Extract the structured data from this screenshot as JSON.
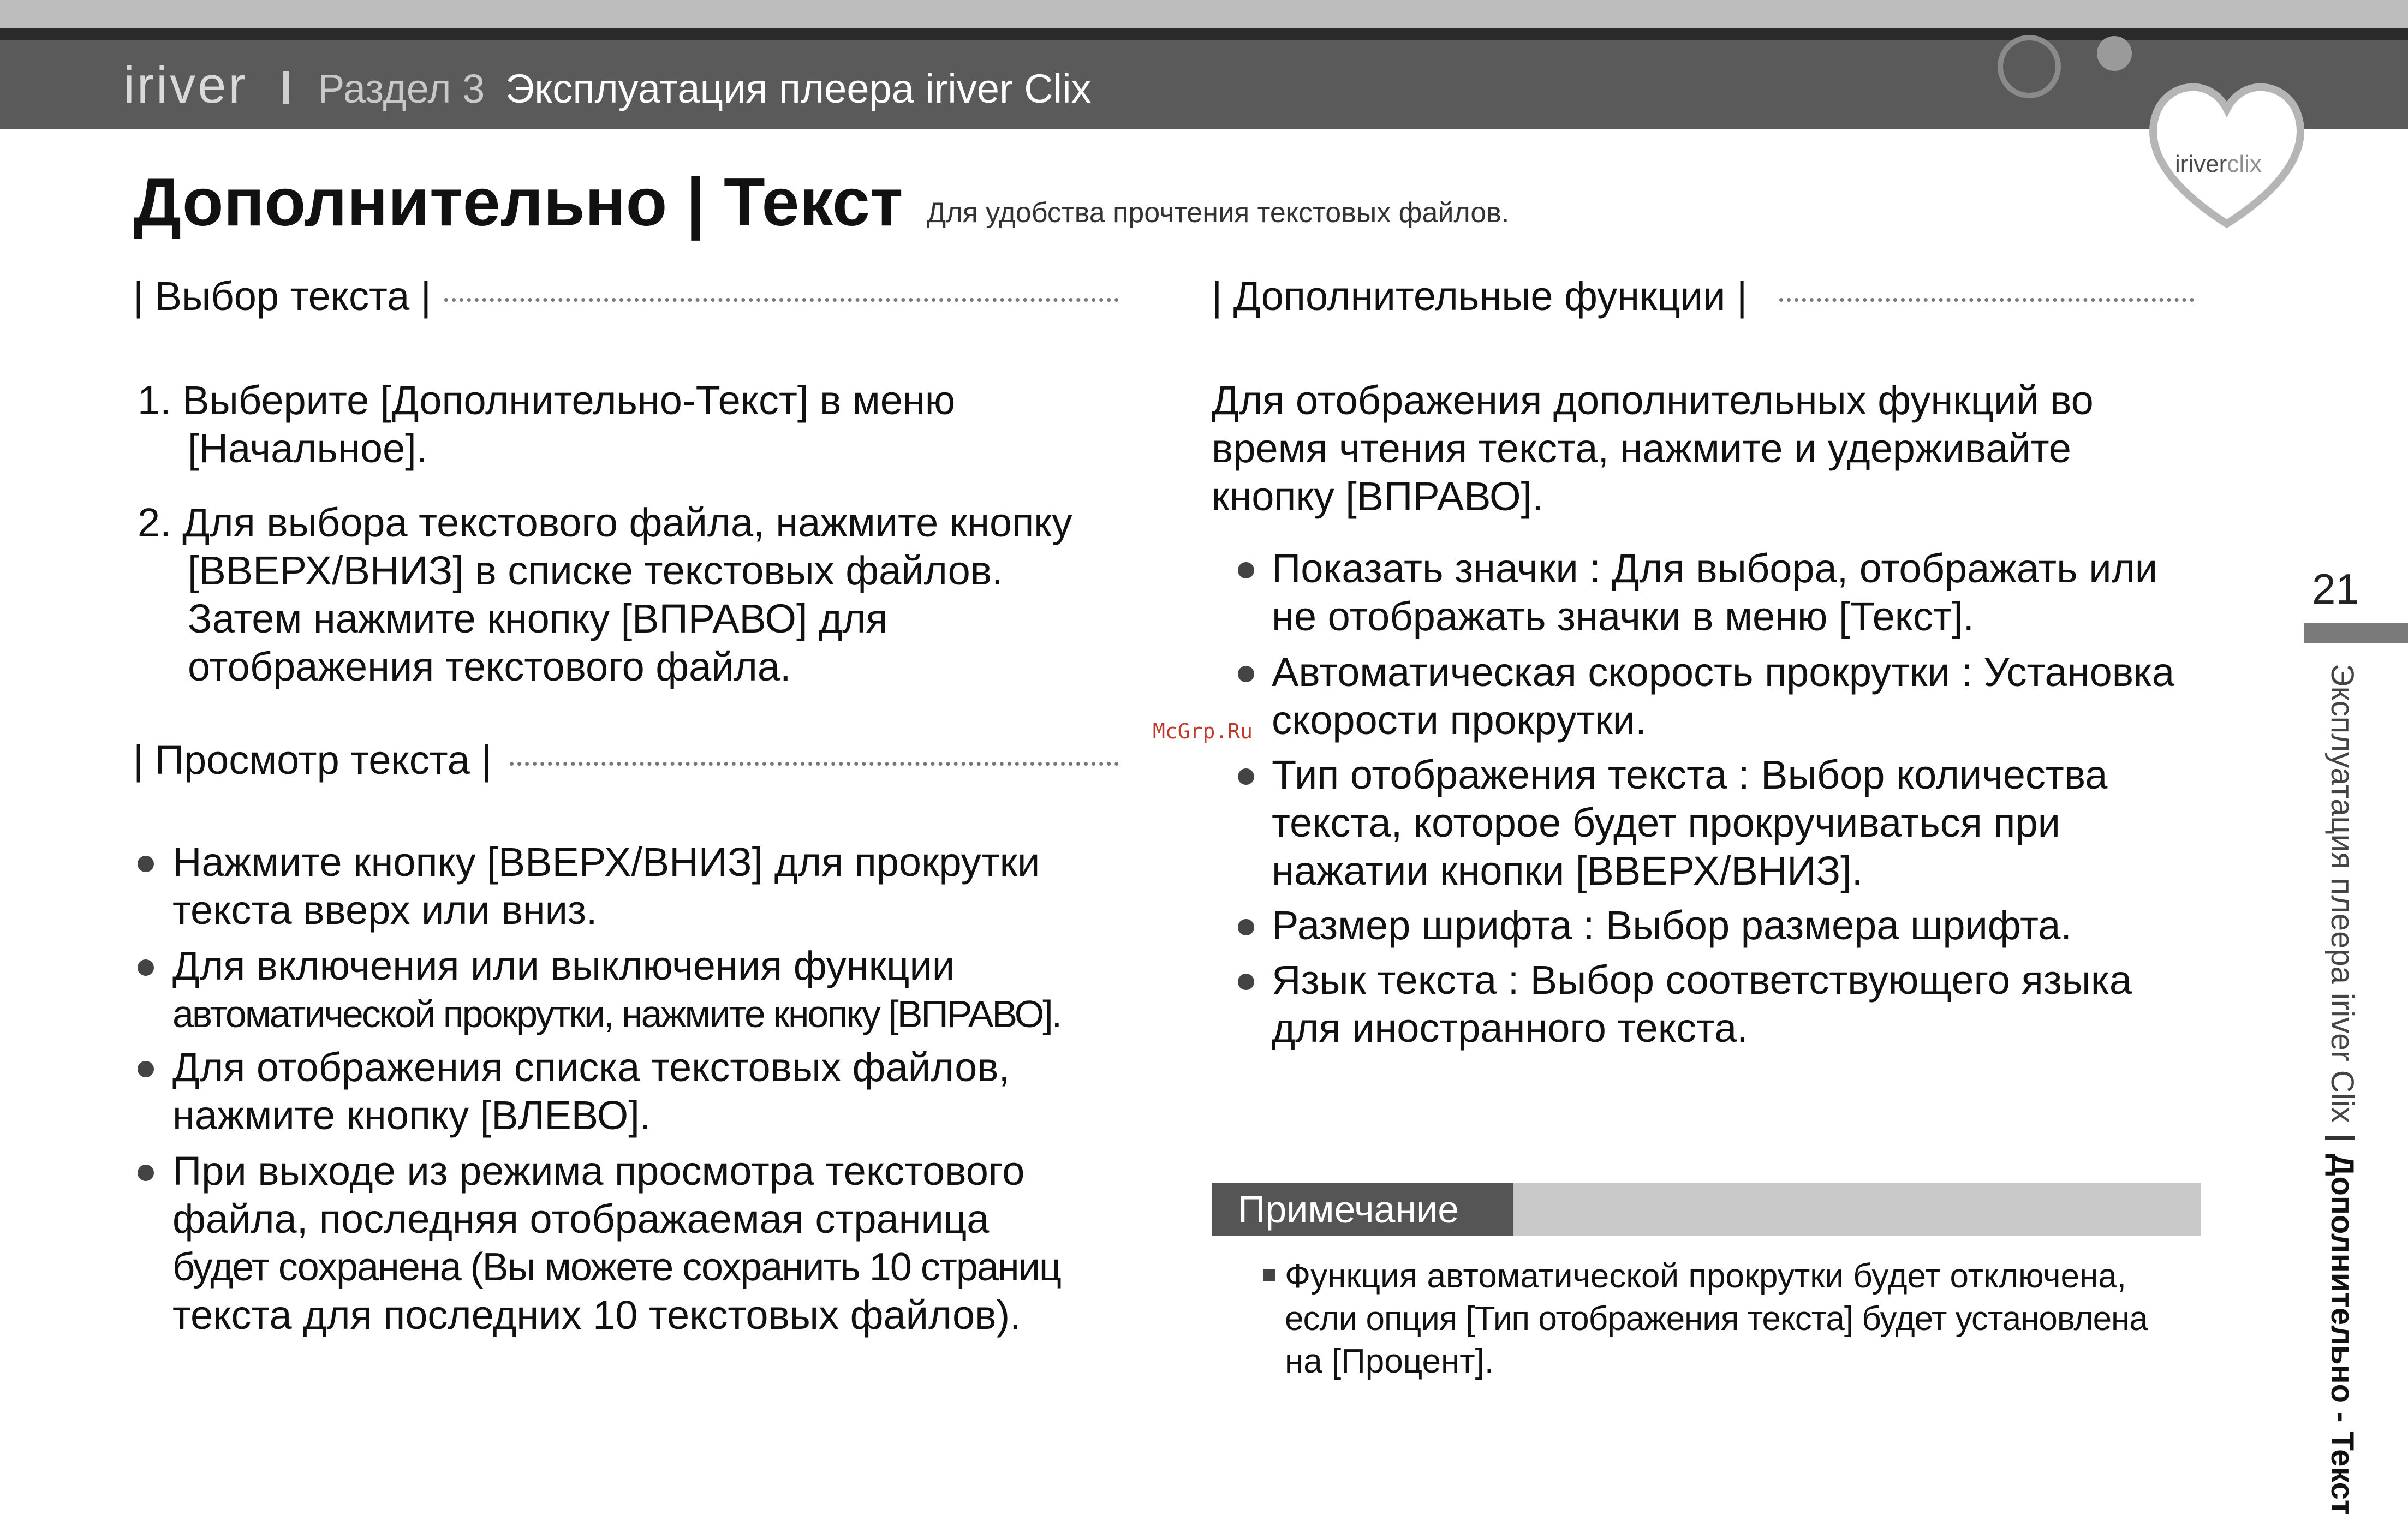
{
  "header": {
    "logo": "iriver",
    "section": "Раздел 3",
    "title": "Эксплуатация плеера iriver Clix",
    "brand_badge": {
      "main": "iriver",
      "sub": "clix"
    }
  },
  "page": {
    "title": "Дополнительно | Текст",
    "subtitle": "Для удобства прочтения текстовых файлов."
  },
  "left": {
    "select": {
      "heading": "| Выбор текста |",
      "steps": [
        {
          "lines": [
            "1. Выберите [Дополнительно-Текст] в меню",
            "[Начальное]."
          ]
        },
        {
          "lines": [
            "2. Для выбора текстового файла, нажмите кнопку",
            "[ВВЕРХ/ВНИЗ] в списке текстовых файлов.",
            "Затем нажмите кнопку [ВПРАВО] для",
            "отображения текстового файла."
          ]
        }
      ]
    },
    "view": {
      "heading": "| Просмотр текста |",
      "bullets": [
        {
          "lines": [
            "Нажмите кнопку [ВВЕРХ/ВНИЗ] для прокрутки",
            "текста вверх или вниз."
          ]
        },
        {
          "lines": [
            "Для включения или выключения функции",
            "автоматической прокрутки, нажмите кнопку [ВПРАВО]."
          ]
        },
        {
          "lines": [
            "Для отображения списка текстовых файлов,",
            "нажмите кнопку [ВЛЕВО]."
          ]
        },
        {
          "lines": [
            "При выходе из режима просмотра текстового",
            "файла, последняя отображаемая страница",
            "будет сохранена (Вы можете сохранить 10 страниц",
            "текста для последних 10 текстовых файлов)."
          ]
        }
      ]
    }
  },
  "right": {
    "heading": "| Дополнительные функции |",
    "intro": [
      "Для отображения дополнительных функций во",
      "время чтения текста, нажмите и удерживайте",
      "кнопку [ВПРАВО]."
    ],
    "bullets": [
      {
        "lines": [
          "Показать значки : Для выбора, отображать или",
          "не отображать значки в меню [Текст]."
        ]
      },
      {
        "lines": [
          "Автоматическая скорость прокрутки : Установка",
          "скорости прокрутки."
        ]
      },
      {
        "lines": [
          "Тип отображения текста : Выбор количества",
          "текста, которое будет прокручиваться при",
          "нажатии кнопки [ВВЕРХ/ВНИЗ]."
        ]
      },
      {
        "lines": [
          "Размер шрифта : Выбор размера шрифта."
        ]
      },
      {
        "lines": [
          "Язык текста : Выбор соответствующего языка",
          "для иностранного текста."
        ]
      }
    ],
    "note": {
      "label": "Примечание",
      "lines": [
        "Функция автоматической прокрутки будет отключена,",
        "если опция [Тип отображения текста] будет установлена",
        "на [Процент]."
      ]
    }
  },
  "side": {
    "page_number": "21",
    "chapter": "Эксплуатация плеера iriver Clix",
    "topic": "Дополнительно - Текст"
  },
  "watermark": "McGrp.Ru",
  "colors": {
    "header_bg": "#5a5a5a",
    "note_label_bg": "#555555",
    "note_bar_bg": "#c8c8c8",
    "watermark": "#c0392b"
  }
}
